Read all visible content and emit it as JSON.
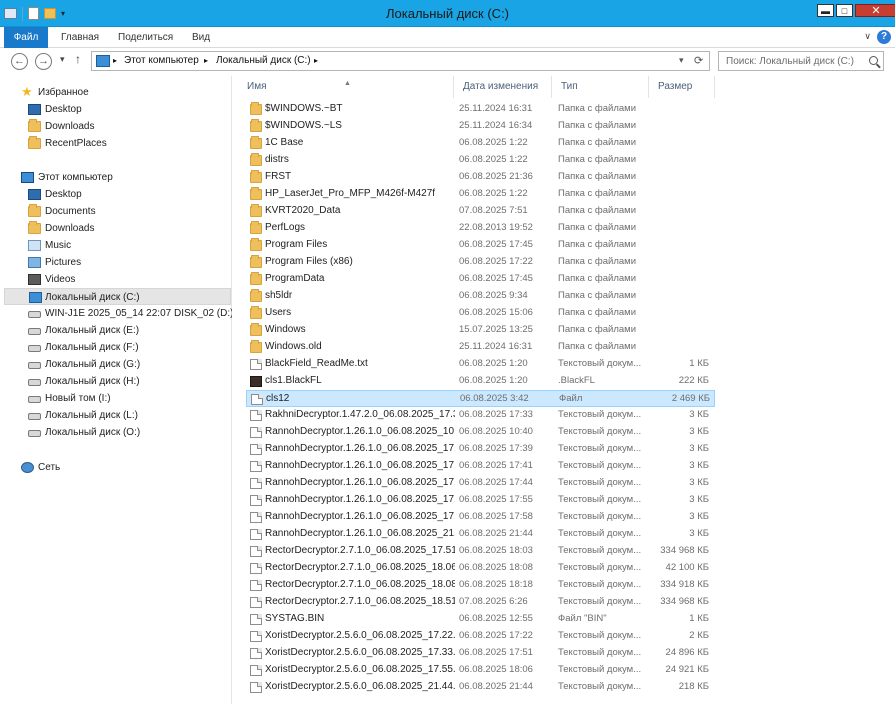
{
  "window": {
    "title": "Локальный диск (C:)",
    "minimize": "▬",
    "maximize": "□",
    "close": "✕"
  },
  "ribbon": {
    "tabs": [
      "Файл",
      "Главная",
      "Поделиться",
      "Вид"
    ],
    "help": "?",
    "chevron": "∨"
  },
  "nav": {
    "back": "←",
    "forward": "→",
    "history": "▾",
    "up": "↑",
    "breadcrumb": [
      "Этот компьютер",
      "Локальный диск (C:)"
    ],
    "separator": "▸",
    "refresh": "⟳",
    "dropdown": "▾",
    "search_placeholder": "Поиск: Локальный диск (C:)"
  },
  "navpane": {
    "favorites_label": "Избранное",
    "favorites": [
      "Desktop",
      "Downloads",
      "RecentPlaces"
    ],
    "computer_label": "Этот компьютер",
    "computer_items": [
      {
        "label": "Desktop",
        "icon": "desktop-icon"
      },
      {
        "label": "Documents",
        "icon": "folder-icon"
      },
      {
        "label": "Downloads",
        "icon": "folder-icon"
      },
      {
        "label": "Music",
        "icon": "music-icon"
      },
      {
        "label": "Pictures",
        "icon": "pictures-icon"
      },
      {
        "label": "Videos",
        "icon": "videos-icon"
      }
    ],
    "drives": [
      "Локальный диск (C:)",
      "WIN-J1E 2025_05_14 22:07 DISK_02 (D:)",
      "Локальный диск (E:)",
      "Локальный диск (F:)",
      "Локальный диск (G:)",
      "Локальный диск (H:)",
      "Новый том (I:)",
      "Локальный диск (L:)",
      "Локальный диск (O:)"
    ],
    "network_label": "Сеть"
  },
  "columns": {
    "name": "Имя",
    "date": "Дата изменения",
    "type": "Тип",
    "size": "Размер"
  },
  "files": [
    {
      "name": "$WINDOWS.~BT",
      "date": "25.11.2024 16:31",
      "type": "Папка с файлами",
      "size": "",
      "kind": "folder"
    },
    {
      "name": "$WINDOWS.~LS",
      "date": "25.11.2024 16:34",
      "type": "Папка с файлами",
      "size": "",
      "kind": "folder"
    },
    {
      "name": "1C Base",
      "date": "06.08.2025 1:22",
      "type": "Папка с файлами",
      "size": "",
      "kind": "folder"
    },
    {
      "name": "distrs",
      "date": "06.08.2025 1:22",
      "type": "Папка с файлами",
      "size": "",
      "kind": "folder"
    },
    {
      "name": "FRST",
      "date": "06.08.2025 21:36",
      "type": "Папка с файлами",
      "size": "",
      "kind": "folder"
    },
    {
      "name": "HP_LaserJet_Pro_MFP_M426f-M427f",
      "date": "06.08.2025 1:22",
      "type": "Папка с файлами",
      "size": "",
      "kind": "folder"
    },
    {
      "name": "KVRT2020_Data",
      "date": "07.08.2025 7:51",
      "type": "Папка с файлами",
      "size": "",
      "kind": "folder"
    },
    {
      "name": "PerfLogs",
      "date": "22.08.2013 19:52",
      "type": "Папка с файлами",
      "size": "",
      "kind": "folder"
    },
    {
      "name": "Program Files",
      "date": "06.08.2025 17:45",
      "type": "Папка с файлами",
      "size": "",
      "kind": "folder"
    },
    {
      "name": "Program Files (x86)",
      "date": "06.08.2025 17:22",
      "type": "Папка с файлами",
      "size": "",
      "kind": "folder"
    },
    {
      "name": "ProgramData",
      "date": "06.08.2025 17:45",
      "type": "Папка с файлами",
      "size": "",
      "kind": "folder"
    },
    {
      "name": "sh5ldr",
      "date": "06.08.2025 9:34",
      "type": "Папка с файлами",
      "size": "",
      "kind": "folder"
    },
    {
      "name": "Users",
      "date": "06.08.2025 15:06",
      "type": "Папка с файлами",
      "size": "",
      "kind": "folder"
    },
    {
      "name": "Windows",
      "date": "15.07.2025 13:25",
      "type": "Папка с файлами",
      "size": "",
      "kind": "folder"
    },
    {
      "name": "Windows.old",
      "date": "25.11.2024 16:31",
      "type": "Папка с файлами",
      "size": "",
      "kind": "folder"
    },
    {
      "name": "BlackField_ReadMe.txt",
      "date": "06.08.2025 1:20",
      "type": "Текстовый докум...",
      "size": "1 КБ",
      "kind": "file"
    },
    {
      "name": "cls1.BlackFL",
      "date": "06.08.2025 1:20",
      "type": ".BlackFL",
      "size": "222 КБ",
      "kind": "exe"
    },
    {
      "name": "cls12",
      "date": "06.08.2025 3:42",
      "type": "Файл",
      "size": "2 469 КБ",
      "kind": "file",
      "selected": true
    },
    {
      "name": "RakhniDecryptor.1.47.2.0_06.08.2025_17.3...",
      "date": "06.08.2025 17:33",
      "type": "Текстовый докум...",
      "size": "3 КБ",
      "kind": "file"
    },
    {
      "name": "RannohDecryptor.1.26.1.0_06.08.2025_10....",
      "date": "06.08.2025 10:40",
      "type": "Текстовый докум...",
      "size": "3 КБ",
      "kind": "file"
    },
    {
      "name": "RannohDecryptor.1.26.1.0_06.08.2025_17....",
      "date": "06.08.2025 17:39",
      "type": "Текстовый докум...",
      "size": "3 КБ",
      "kind": "file"
    },
    {
      "name": "RannohDecryptor.1.26.1.0_06.08.2025_17....",
      "date": "06.08.2025 17:41",
      "type": "Текстовый докум...",
      "size": "3 КБ",
      "kind": "file"
    },
    {
      "name": "RannohDecryptor.1.26.1.0_06.08.2025_17....",
      "date": "06.08.2025 17:44",
      "type": "Текстовый докум...",
      "size": "3 КБ",
      "kind": "file"
    },
    {
      "name": "RannohDecryptor.1.26.1.0_06.08.2025_17....",
      "date": "06.08.2025 17:55",
      "type": "Текстовый докум...",
      "size": "3 КБ",
      "kind": "file"
    },
    {
      "name": "RannohDecryptor.1.26.1.0_06.08.2025_17....",
      "date": "06.08.2025 17:58",
      "type": "Текстовый докум...",
      "size": "3 КБ",
      "kind": "file"
    },
    {
      "name": "RannohDecryptor.1.26.1.0_06.08.2025_21....",
      "date": "06.08.2025 21:44",
      "type": "Текстовый докум...",
      "size": "3 КБ",
      "kind": "file"
    },
    {
      "name": "RectorDecryptor.2.7.1.0_06.08.2025_17.51....",
      "date": "06.08.2025 18:03",
      "type": "Текстовый докум...",
      "size": "334 968 КБ",
      "kind": "file"
    },
    {
      "name": "RectorDecryptor.2.7.1.0_06.08.2025_18.06....",
      "date": "06.08.2025 18:08",
      "type": "Текстовый докум...",
      "size": "42 100 КБ",
      "kind": "file"
    },
    {
      "name": "RectorDecryptor.2.7.1.0_06.08.2025_18.08....",
      "date": "06.08.2025 18:18",
      "type": "Текстовый докум...",
      "size": "334 918 КБ",
      "kind": "file"
    },
    {
      "name": "RectorDecryptor.2.7.1.0_06.08.2025_18.51....",
      "date": "07.08.2025 6:26",
      "type": "Текстовый докум...",
      "size": "334 968 КБ",
      "kind": "file"
    },
    {
      "name": "SYSTAG.BIN",
      "date": "06.08.2025 12:55",
      "type": "Файл \"BIN\"",
      "size": "1 КБ",
      "kind": "file"
    },
    {
      "name": "XoristDecryptor.2.5.6.0_06.08.2025_17.22....",
      "date": "06.08.2025 17:22",
      "type": "Текстовый докум...",
      "size": "2 КБ",
      "kind": "file"
    },
    {
      "name": "XoristDecryptor.2.5.6.0_06.08.2025_17.33....",
      "date": "06.08.2025 17:51",
      "type": "Текстовый докум...",
      "size": "24 896 КБ",
      "kind": "file"
    },
    {
      "name": "XoristDecryptor.2.5.6.0_06.08.2025_17.55....",
      "date": "06.08.2025 18:06",
      "type": "Текстовый докум...",
      "size": "24 921 КБ",
      "kind": "file"
    },
    {
      "name": "XoristDecryptor.2.5.6.0_06.08.2025_21.44....",
      "date": "06.08.2025 21:44",
      "type": "Текстовый докум...",
      "size": "218 КБ",
      "kind": "file"
    }
  ],
  "colors": {
    "titlebar": "#19a4e6",
    "file_tab": "#1979ca",
    "selection": "#cce8ff",
    "folder": "#eec05c"
  }
}
